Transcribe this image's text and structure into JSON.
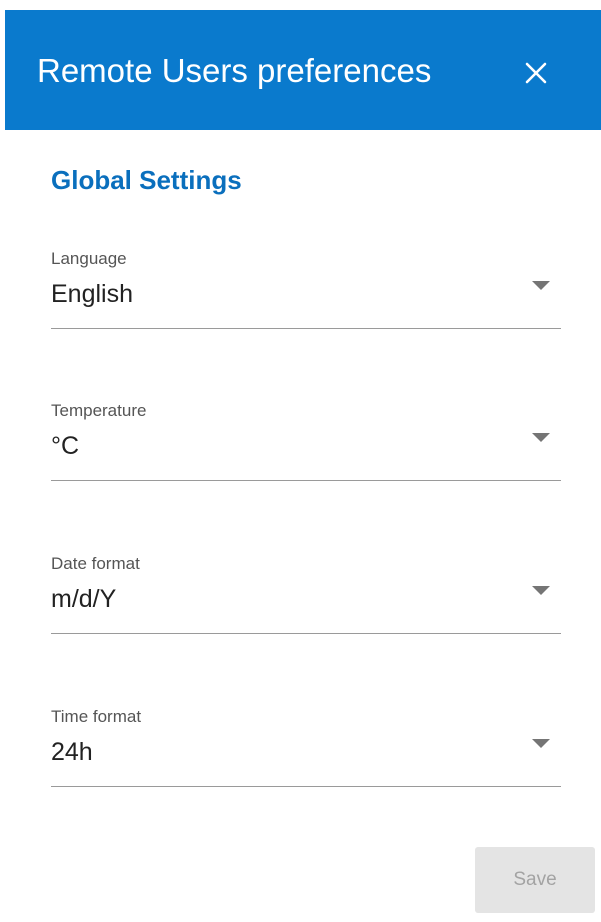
{
  "dialog": {
    "title": "Remote Users preferences",
    "close_icon": "close-icon",
    "header_color": "#0a7acd"
  },
  "section": {
    "title": "Global Settings",
    "title_color": "#0a6fbd"
  },
  "fields": [
    {
      "label": "Language",
      "value": "English",
      "icon": "chevron-down-icon"
    },
    {
      "label": "Temperature",
      "value": "°C",
      "icon": "chevron-down-icon"
    },
    {
      "label": "Date format",
      "value": "m/d/Y",
      "icon": "chevron-down-icon"
    },
    {
      "label": "Time format",
      "value": "24h",
      "icon": "chevron-down-icon"
    }
  ],
  "actions": {
    "save_label": "Save",
    "save_disabled": true
  }
}
